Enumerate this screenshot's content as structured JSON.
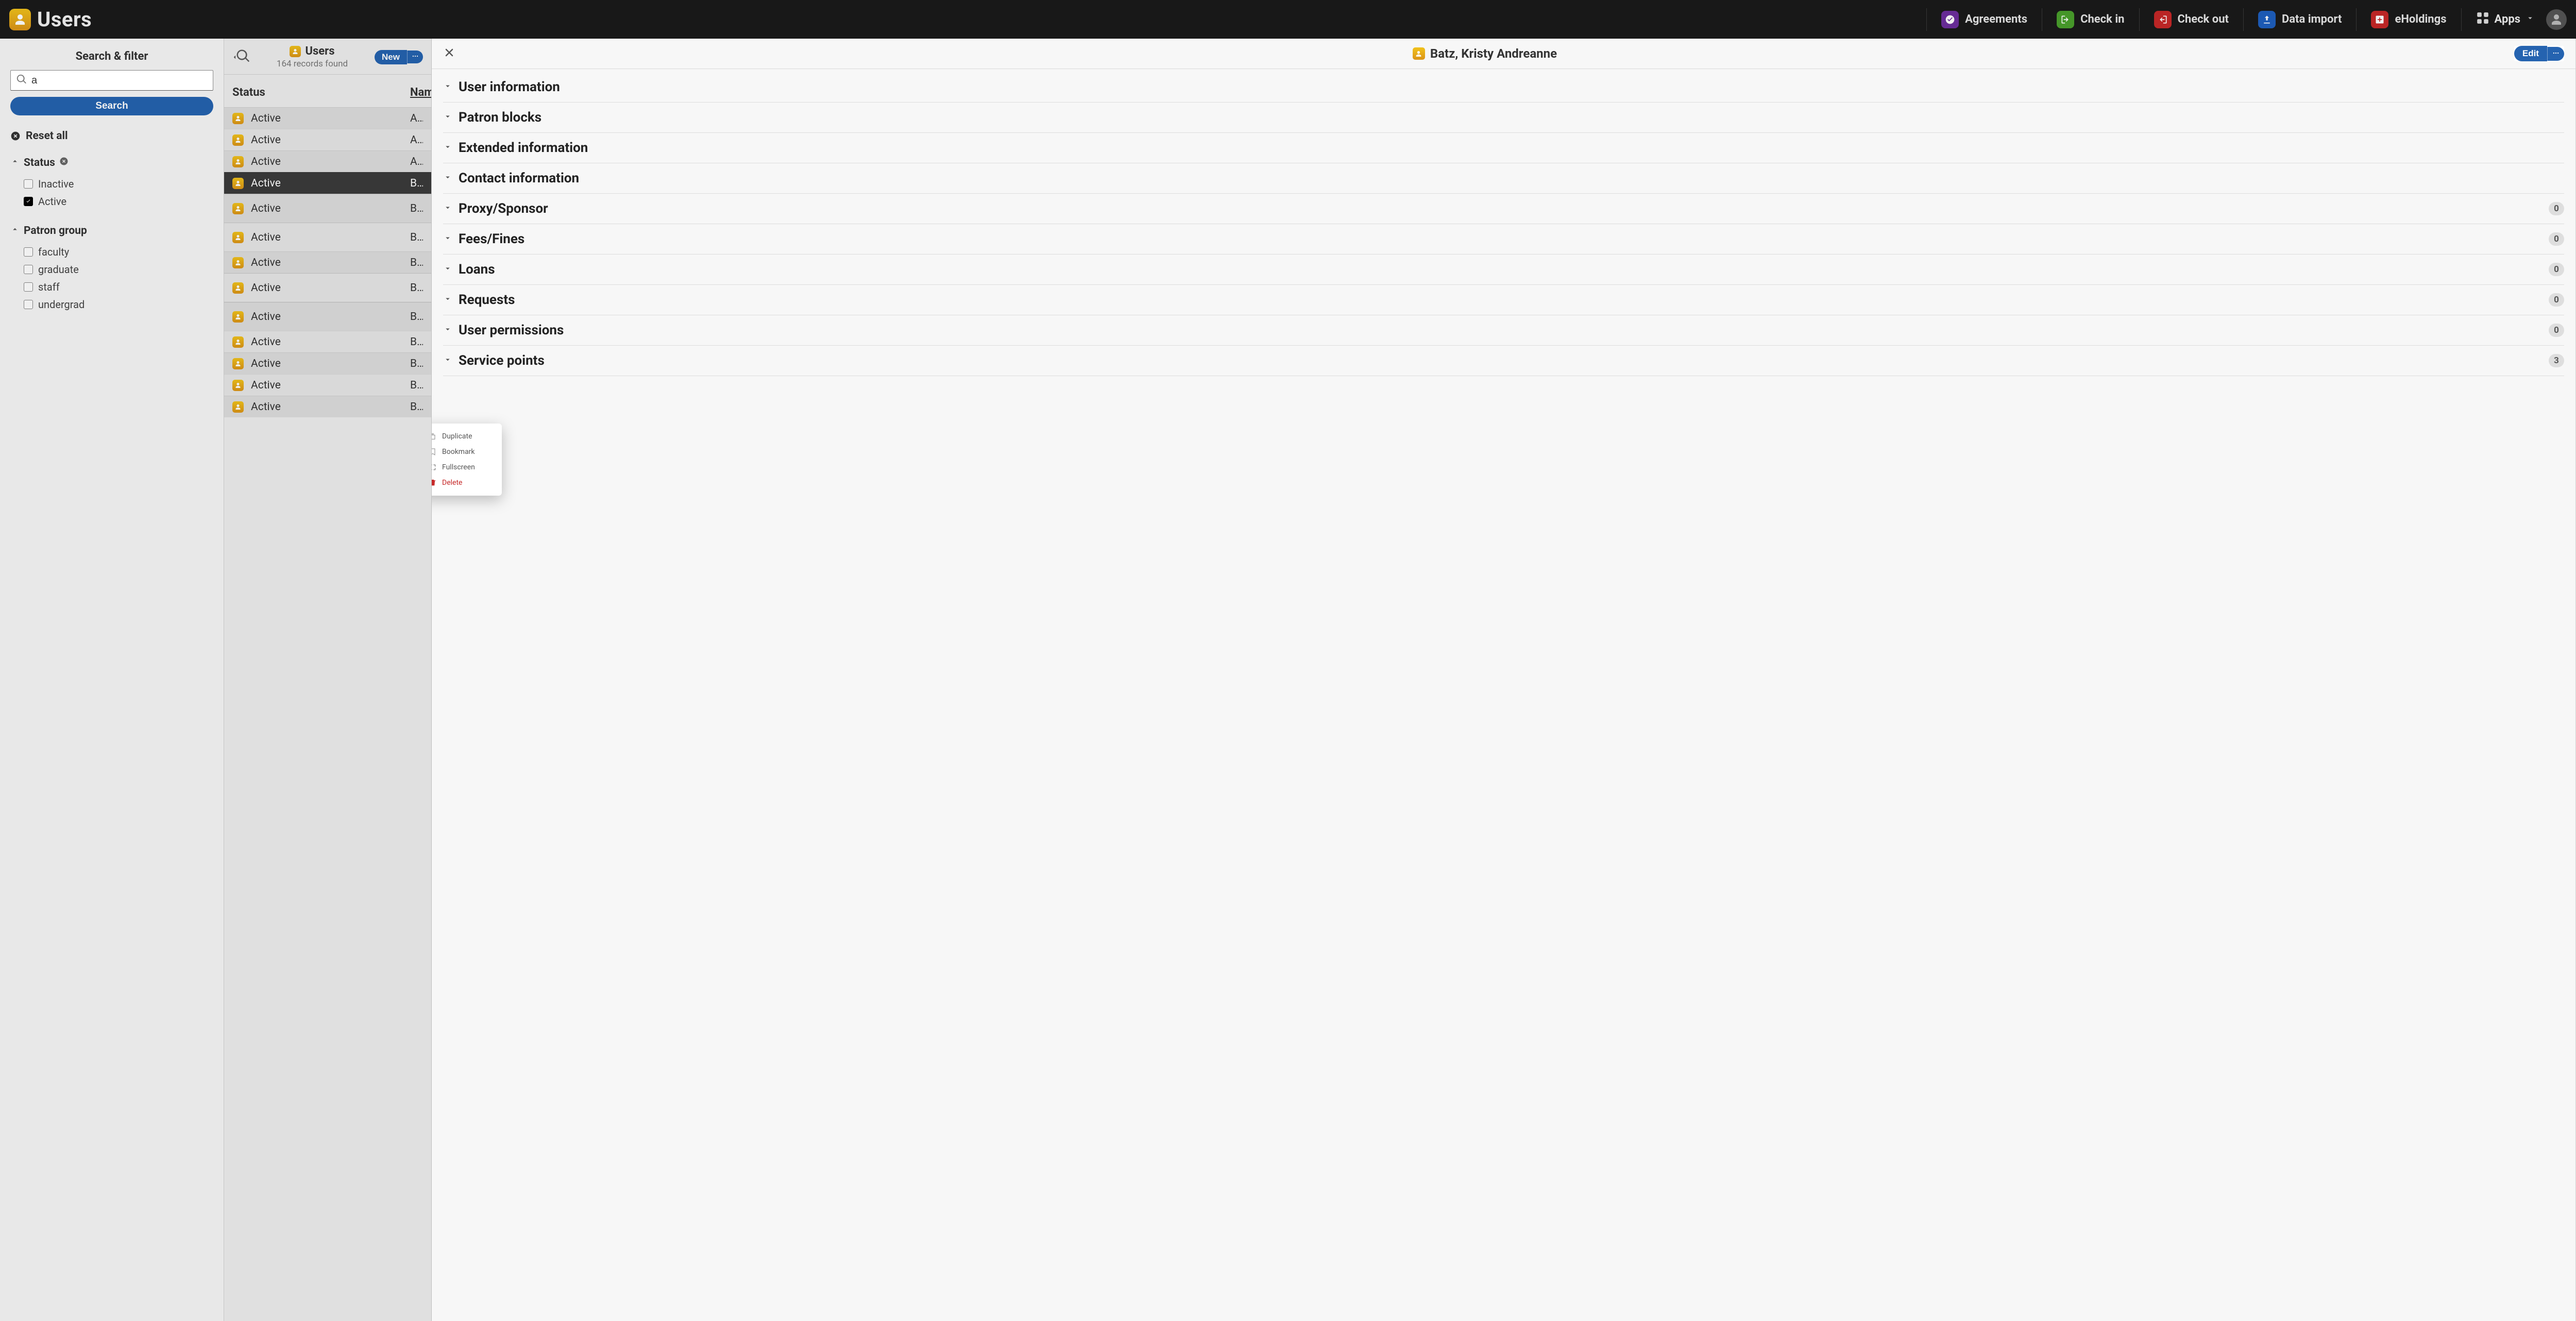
{
  "app": {
    "title": "Users",
    "nav": [
      {
        "label": "Agreements",
        "icon": "checkmark-circle-icon",
        "iconclass": "ic-agreements"
      },
      {
        "label": "Check in",
        "icon": "login-icon",
        "iconclass": "ic-checkin"
      },
      {
        "label": "Check out",
        "icon": "logout-icon",
        "iconclass": "ic-checkout"
      },
      {
        "label": "Data import",
        "icon": "upload-icon",
        "iconclass": "ic-dataimport"
      },
      {
        "label": "eHoldings",
        "icon": "plus-box-icon",
        "iconclass": "ic-eholdings"
      }
    ],
    "apps_label": "Apps"
  },
  "search_panel": {
    "title": "Search & filter",
    "query": "a",
    "search_label": "Search",
    "reset_label": "Reset all",
    "filters": {
      "status": {
        "label": "Status",
        "has_active_filter": true,
        "options": [
          {
            "label": "Inactive",
            "checked": false
          },
          {
            "label": "Active",
            "checked": true
          }
        ]
      },
      "patron_group": {
        "label": "Patron group",
        "options": [
          {
            "label": "faculty",
            "checked": false
          },
          {
            "label": "graduate",
            "checked": false
          },
          {
            "label": "staff",
            "checked": false
          },
          {
            "label": "undergrad",
            "checked": false
          }
        ]
      }
    }
  },
  "list_panel": {
    "title": "Users",
    "records_found_label": "164 records found",
    "new_label": "New",
    "columns": {
      "status": "Status",
      "name": "Name"
    },
    "rows": [
      {
        "status": "Active",
        "name": "ADM",
        "selected": false,
        "sep": false
      },
      {
        "status": "Active",
        "name": "Auer",
        "selected": false,
        "sep": false
      },
      {
        "status": "Active",
        "name": "Auer",
        "selected": false,
        "sep": false
      },
      {
        "status": "Active",
        "name": "Batz",
        "selected": true,
        "sep": false
      },
      {
        "status": "Active",
        "name": "Baye",
        "selected": false,
        "sep": true
      },
      {
        "status": "Active",
        "name": "Beck",
        "selected": false,
        "sep": true
      },
      {
        "status": "Active",
        "name": "Bedn",
        "selected": false,
        "sep": false
      },
      {
        "status": "Active",
        "name": "Berg",
        "selected": false,
        "sep": true
      },
      {
        "status": "Active",
        "name": "Bern",
        "selected": false,
        "sep": true
      },
      {
        "status": "Active",
        "name": "Bloc",
        "selected": false,
        "sep": false
      },
      {
        "status": "Active",
        "name": "Bloc",
        "selected": false,
        "sep": false
      },
      {
        "status": "Active",
        "name": "Boeh",
        "selected": false,
        "sep": false
      },
      {
        "status": "Active",
        "name": "Bore",
        "selected": false,
        "sep": false
      }
    ]
  },
  "detail_panel": {
    "title": "Batz, Kristy Andreanne",
    "edit_label": "Edit",
    "sections": [
      {
        "title": "User information",
        "count": null
      },
      {
        "title": "Patron blocks",
        "count": null
      },
      {
        "title": "Extended information",
        "count": null
      },
      {
        "title": "Contact information",
        "count": null
      },
      {
        "title": "Proxy/Sponsor",
        "count": 0
      },
      {
        "title": "Fees/Fines",
        "count": 0
      },
      {
        "title": "Loans",
        "count": 0
      },
      {
        "title": "Requests",
        "count": 0
      },
      {
        "title": "User permissions",
        "count": 0
      },
      {
        "title": "Service points",
        "count": 3
      }
    ],
    "actions_menu": [
      {
        "label": "Duplicate",
        "icon": "copy-icon",
        "class": ""
      },
      {
        "label": "Bookmark",
        "icon": "bookmark-icon",
        "class": ""
      },
      {
        "label": "Fullscreen",
        "icon": "expand-icon",
        "class": ""
      },
      {
        "label": "Delete",
        "icon": "trash-icon",
        "class": "delete"
      }
    ]
  }
}
